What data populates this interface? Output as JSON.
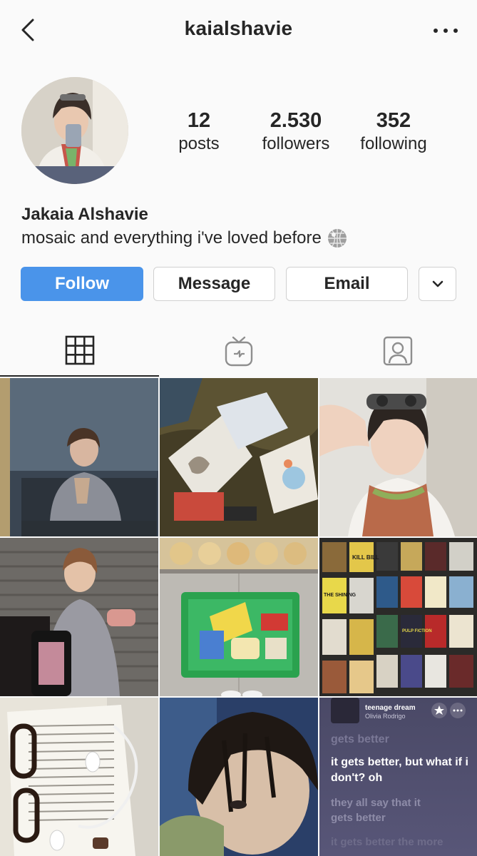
{
  "header": {
    "username": "kaialshavie",
    "back_icon": "chevron-left-icon",
    "more_icon": "ellipsis-icon"
  },
  "stats": {
    "posts": {
      "value": "12",
      "label": "posts"
    },
    "followers": {
      "value": "2.530",
      "label": "followers"
    },
    "following": {
      "value": "352",
      "label": "following"
    }
  },
  "profile": {
    "name": "Jakaia Alshavie",
    "bio": "mosaic and everything i've loved before",
    "bio_emoji": "disco-ball-icon"
  },
  "actions": {
    "follow_label": "Follow",
    "message_label": "Message",
    "email_label": "Email",
    "more_icon": "chevron-down-icon"
  },
  "tabs": [
    {
      "name": "posts",
      "icon": "grid-icon",
      "active": true
    },
    {
      "name": "igtv",
      "icon": "tv-icon",
      "active": false
    },
    {
      "name": "tagged",
      "icon": "person-tag-icon",
      "active": false
    }
  ],
  "posts": [
    {
      "description": "person sitting by window clasping hands"
    },
    {
      "description": "sketchbooks on grass"
    },
    {
      "description": "selfie with goggles and knit scarf"
    },
    {
      "description": "person smiling at camera with phone"
    },
    {
      "description": "green basket of snacks"
    },
    {
      "description": "wall of movie posters"
    },
    {
      "description": "book with glasses and earbuds"
    },
    {
      "description": "close-up face under hair"
    },
    {
      "description": "lyrics screenshot"
    }
  ],
  "lyrics_card": {
    "song": "teenage dream",
    "artist": "Olivia Rodrigo",
    "line_faded_top": "gets better",
    "line_current": "it gets better, but what if i don't? oh",
    "line_next": "they all say that it gets better",
    "line_faded_bottom": "it gets better the more"
  },
  "poster_text": {
    "p1": "KILL BILL",
    "p2": "THE SHINING",
    "p3": "PULP FICTION"
  },
  "colors": {
    "accent": "#4a94ea",
    "text": "#262626",
    "background": "#fafafa"
  }
}
